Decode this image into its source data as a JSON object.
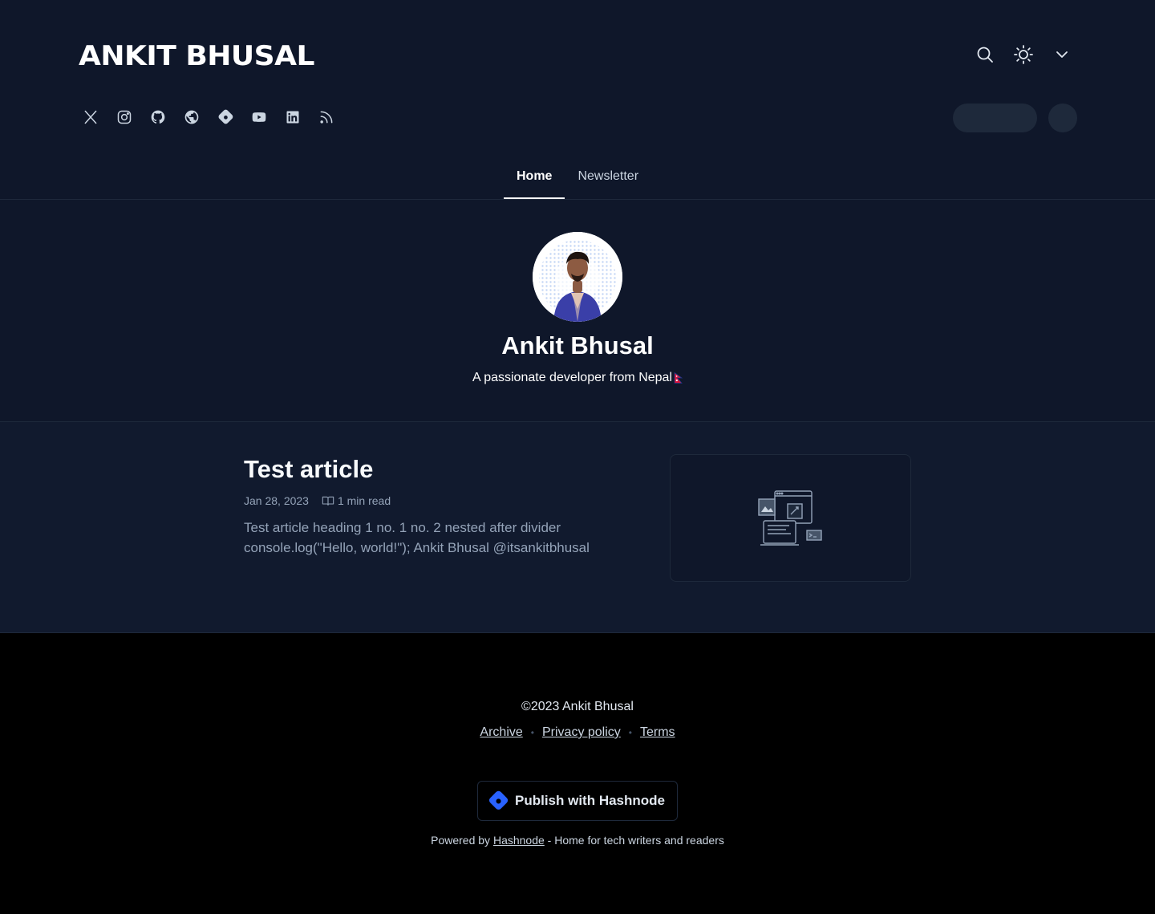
{
  "header": {
    "brand": "ANKIT BHUSAL",
    "actions": [
      {
        "name": "search-icon"
      },
      {
        "name": "sun-icon"
      },
      {
        "name": "chevron-down-icon"
      }
    ],
    "socials": [
      "x-icon",
      "instagram-icon",
      "github-icon",
      "globe-icon",
      "hashnode-icon",
      "youtube-icon",
      "linkedin-icon",
      "rss-icon"
    ],
    "tabs": [
      {
        "label": "Home",
        "active": true
      },
      {
        "label": "Newsletter",
        "active": false
      }
    ]
  },
  "profile": {
    "name": "Ankit Bhusal",
    "bio": "A passionate developer from Nepal"
  },
  "posts": [
    {
      "title": "Test article",
      "date": "Jan 28, 2023",
      "read_time": "1 min read",
      "excerpt": "Test article heading 1 no. 1 no. 2 nested after divider console.log(\"Hello, world!\"); Ankit Bhusal @itsankitbhusal"
    }
  ],
  "footer": {
    "copyright": "©2023 Ankit Bhusal",
    "links": [
      "Archive",
      "Privacy policy",
      "Terms"
    ],
    "publish_label": "Publish with Hashnode",
    "powered_prefix": "Powered by",
    "powered_link": "Hashnode",
    "powered_suffix": "- Home for tech writers and readers"
  },
  "colors": {
    "background": "#0f172a",
    "footer_background": "#000000",
    "hashnode_blue": "#2962ff"
  }
}
